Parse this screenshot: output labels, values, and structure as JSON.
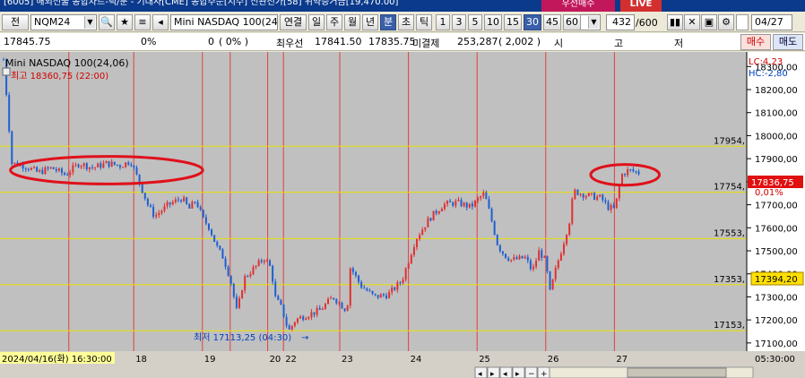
{
  "titlebar": {
    "title": "[6005] 해외선물 종합차트-틱/분 - 기대사[CME] 종합주문[지수] 신관전가[58] 위약증거금[19,470.00]",
    "buy_button": "우선매수",
    "live_button": "LIVE"
  },
  "toolbar": {
    "mode_label": "전",
    "symbol": "NQM24",
    "symbol_name": "Mini NASDAQ 100(24.0",
    "link_label": "연결",
    "periods": [
      "일",
      "주",
      "월",
      "년",
      "분",
      "초",
      "틱"
    ],
    "active_period": "분",
    "intervals": [
      "1",
      "3",
      "5",
      "10",
      "15",
      "30",
      "45",
      "60"
    ],
    "active_interval": "30",
    "interval_select": "30",
    "count": "432",
    "count_max": "/600",
    "date": "04/27"
  },
  "quote": {
    "price": "17845.75",
    "change_pct": "0%",
    "change": "0",
    "change_paren": "(      0%  )",
    "best_bid_label": "최우선",
    "bid": "17841.50",
    "ask": "17835.75",
    "open_interest_label": "미결제",
    "open_interest": "253,287",
    "oi_change": "( 2,002  )",
    "open_label": "시",
    "high_label": "고",
    "low_label": "저",
    "sell_button": "매수",
    "buy_button": "매도"
  },
  "chart_data": {
    "type": "candlestick",
    "title": "Mini NASDAQ 100(24,06)",
    "high_annotation": "최고 18360,75 (22:00)",
    "low_annotation": "최저 17113,25 (04:30)",
    "lc_label": "LC:4,23",
    "hc_label": "HC:-2,80",
    "y_ticks": [
      18300,
      18200,
      18100,
      18000,
      17900,
      17800,
      17700,
      17600,
      17500,
      17400,
      17300,
      17200,
      17100
    ],
    "y_tick_labels": [
      "18300,00",
      "18200,00",
      "18100,00",
      "18000,00",
      "17900,00",
      "17800,00",
      "17700,00",
      "17600,00",
      "17500,00",
      "17400,00",
      "17300,00",
      "17200,00",
      "17100,00"
    ],
    "ylim": [
      17080,
      18340
    ],
    "horizontal_levels": [
      {
        "value": 17954,
        "label": "17954,"
      },
      {
        "value": 17754,
        "label": "17754,"
      },
      {
        "value": 17553,
        "label": "17553,"
      },
      {
        "value": 17353,
        "label": "17353,"
      },
      {
        "value": 17153,
        "label": "17153,"
      }
    ],
    "current_price": {
      "value": 17836.75,
      "label": "17836,75",
      "pct": "0,01%"
    },
    "ref_price": {
      "value": 17394.2,
      "label": "17394,20"
    },
    "x_labels": [
      {
        "label": "2024/04/16(화) 16:30:00",
        "pos": 0.0
      },
      {
        "label": "18",
        "pos": 0.2
      },
      {
        "label": "19",
        "pos": 0.3
      },
      {
        "label": "20",
        "pos": 0.395
      },
      {
        "label": "22",
        "pos": 0.418
      },
      {
        "label": "23",
        "pos": 0.5
      },
      {
        "label": "24",
        "pos": 0.6
      },
      {
        "label": "25",
        "pos": 0.7
      },
      {
        "label": "26",
        "pos": 0.8
      },
      {
        "label": "27",
        "pos": 0.9
      }
    ],
    "time_end_label": "05:30:00",
    "path": [
      [
        0,
        18330
      ],
      [
        0.005,
        18150
      ],
      [
        0.012,
        17880
      ],
      [
        0.03,
        17870
      ],
      [
        0.05,
        17840
      ],
      [
        0.07,
        17860
      ],
      [
        0.09,
        17830
      ],
      [
        0.11,
        17880
      ],
      [
        0.13,
        17860
      ],
      [
        0.15,
        17880
      ],
      [
        0.17,
        17870
      ],
      [
        0.185,
        17890
      ],
      [
        0.2,
        17780
      ],
      [
        0.21,
        17700
      ],
      [
        0.22,
        17650
      ],
      [
        0.24,
        17700
      ],
      [
        0.26,
        17730
      ],
      [
        0.27,
        17680
      ],
      [
        0.28,
        17720
      ],
      [
        0.29,
        17640
      ],
      [
        0.3,
        17600
      ],
      [
        0.31,
        17520
      ],
      [
        0.32,
        17470
      ],
      [
        0.33,
        17380
      ],
      [
        0.34,
        17230
      ],
      [
        0.35,
        17380
      ],
      [
        0.36,
        17410
      ],
      [
        0.37,
        17440
      ],
      [
        0.38,
        17470
      ],
      [
        0.39,
        17420
      ],
      [
        0.395,
        17300
      ],
      [
        0.405,
        17250
      ],
      [
        0.415,
        17150
      ],
      [
        0.425,
        17200
      ],
      [
        0.44,
        17220
      ],
      [
        0.46,
        17240
      ],
      [
        0.48,
        17300
      ],
      [
        0.5,
        17240
      ],
      [
        0.505,
        17430
      ],
      [
        0.52,
        17350
      ],
      [
        0.54,
        17300
      ],
      [
        0.56,
        17310
      ],
      [
        0.58,
        17370
      ],
      [
        0.6,
        17550
      ],
      [
        0.62,
        17640
      ],
      [
        0.64,
        17700
      ],
      [
        0.66,
        17710
      ],
      [
        0.68,
        17690
      ],
      [
        0.7,
        17750
      ],
      [
        0.71,
        17640
      ],
      [
        0.72,
        17520
      ],
      [
        0.73,
        17480
      ],
      [
        0.74,
        17460
      ],
      [
        0.76,
        17470
      ],
      [
        0.77,
        17410
      ],
      [
        0.78,
        17500
      ],
      [
        0.79,
        17450
      ],
      [
        0.795,
        17310
      ],
      [
        0.805,
        17430
      ],
      [
        0.815,
        17530
      ],
      [
        0.825,
        17640
      ],
      [
        0.83,
        17760
      ],
      [
        0.85,
        17740
      ],
      [
        0.87,
        17730
      ],
      [
        0.88,
        17690
      ],
      [
        0.89,
        17680
      ],
      [
        0.9,
        17830
      ],
      [
        0.91,
        17850
      ],
      [
        0.925,
        17840
      ]
    ],
    "ellipses": [
      {
        "cx": 0.15,
        "cy": 17850,
        "rx": 0.14,
        "ry": 60
      },
      {
        "cx": 0.905,
        "cy": 17830,
        "rx": 0.05,
        "ry": 45
      }
    ]
  },
  "colors": {
    "chart_bg": "#c0c0c0",
    "up": "#e03030",
    "down": "#1f5fd0",
    "level_line": "#e8e000",
    "vertical_line": "#e04040",
    "ellipse": "#e0101a"
  }
}
